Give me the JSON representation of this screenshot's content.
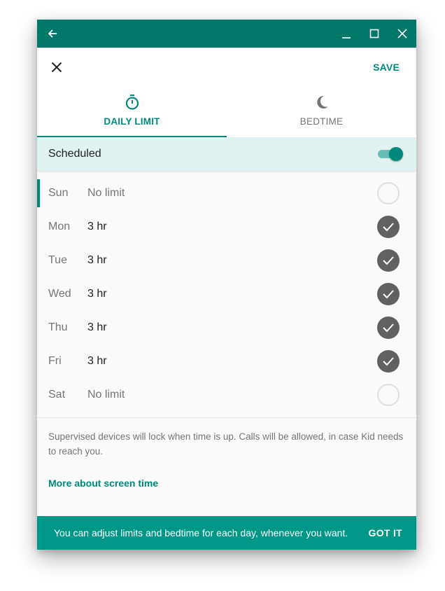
{
  "titlebar": {
    "back_icon": "arrow-left-icon",
    "minimize_icon": "minimize-icon",
    "maximize_icon": "maximize-icon",
    "close_icon": "close-icon",
    "color": "#00796b"
  },
  "header": {
    "close_icon": "close-icon",
    "save_label": "SAVE"
  },
  "tabs": [
    {
      "label": "DAILY LIMIT",
      "icon": "timer-icon",
      "active": true
    },
    {
      "label": "BEDTIME",
      "icon": "moon-icon",
      "active": false
    }
  ],
  "scheduled": {
    "label": "Scheduled",
    "enabled": true
  },
  "days": [
    {
      "day": "Sun",
      "limit": "No limit",
      "checked": false,
      "selected": true
    },
    {
      "day": "Mon",
      "limit": "3 hr",
      "checked": true,
      "selected": false
    },
    {
      "day": "Tue",
      "limit": "3 hr",
      "checked": true,
      "selected": false
    },
    {
      "day": "Wed",
      "limit": "3 hr",
      "checked": true,
      "selected": false
    },
    {
      "day": "Thu",
      "limit": "3 hr",
      "checked": true,
      "selected": false
    },
    {
      "day": "Fri",
      "limit": "3 hr",
      "checked": true,
      "selected": false
    },
    {
      "day": "Sat",
      "limit": "No limit",
      "checked": false,
      "selected": false
    }
  ],
  "note": "Supervised devices will lock when time is up. Calls will be allowed, in case Kid needs to reach you.",
  "more_link": "More about screen time",
  "snackbar": {
    "message": "You can adjust limits and bedtime for each day, whenever you want.",
    "action": "GOT IT"
  },
  "colors": {
    "accent": "#00897b",
    "snackbar": "#009688",
    "scheduled_bg": "#e0f2f1"
  }
}
